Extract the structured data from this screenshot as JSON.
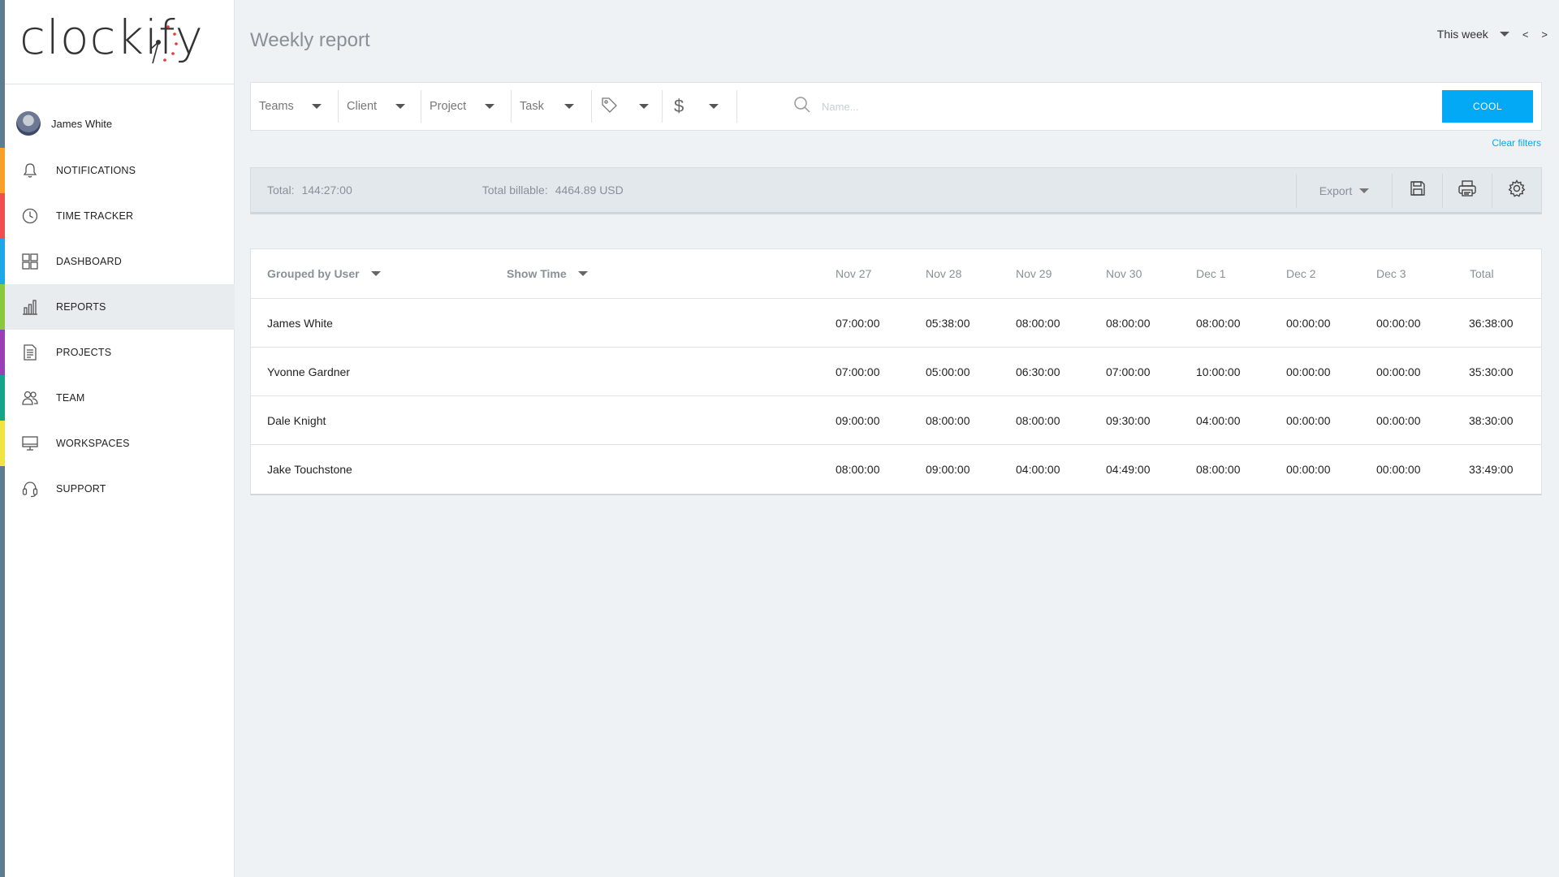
{
  "app": {
    "logo_text": "clockify",
    "accent_color": "#03a9f4"
  },
  "sidebar": {
    "user": {
      "name": "James White"
    },
    "items": [
      {
        "label": "NOTIFICATIONS",
        "icon": "bell-icon",
        "strip_color": "#f7a02a"
      },
      {
        "label": "TIME TRACKER",
        "icon": "clock-icon",
        "strip_color": "#ef4f4f"
      },
      {
        "label": "DASHBOARD",
        "icon": "grid-icon",
        "strip_color": "#1ea7e8"
      },
      {
        "label": "REPORTS",
        "icon": "bar-chart-icon",
        "strip_color": "#8dc63f",
        "active": true
      },
      {
        "label": "PROJECTS",
        "icon": "document-icon",
        "strip_color": "#9b3fb5"
      },
      {
        "label": "TEAM",
        "icon": "team-icon",
        "strip_color": "#17a589"
      },
      {
        "label": "WORKSPACES",
        "icon": "monitor-icon",
        "strip_color": "#f1e342"
      },
      {
        "label": "SUPPORT",
        "icon": "headset-icon",
        "strip_color": "#5f7b8f"
      }
    ]
  },
  "header": {
    "title": "Weekly report",
    "range": "This week",
    "prev": "<",
    "next": ">"
  },
  "filters": {
    "teams": "Teams",
    "client": "Client",
    "project": "Project",
    "task": "Task",
    "tag_icon": "tag-icon",
    "billable_symbol": "$",
    "search_placeholder": "Name...",
    "apply_button": "COOL",
    "clear": "Clear filters"
  },
  "totals": {
    "total_label": "Total:",
    "total_value": "144:27:00",
    "billable_label": "Total billable:",
    "billable_value": "4464.89 USD",
    "export_label": "Export"
  },
  "table": {
    "group_by": "Grouped by User",
    "show": "Show Time",
    "days": [
      "Nov 27",
      "Nov 28",
      "Nov 29",
      "Nov 30",
      "Dec 1",
      "Dec 2",
      "Dec 3"
    ],
    "total_header": "Total",
    "rows": [
      {
        "name": "James White",
        "times": [
          "07:00:00",
          "05:38:00",
          "08:00:00",
          "08:00:00",
          "08:00:00",
          "00:00:00",
          "00:00:00"
        ],
        "total": "36:38:00"
      },
      {
        "name": "Yvonne Gardner",
        "times": [
          "07:00:00",
          "05:00:00",
          "06:30:00",
          "07:00:00",
          "10:00:00",
          "00:00:00",
          "00:00:00"
        ],
        "total": "35:30:00"
      },
      {
        "name": "Dale Knight",
        "times": [
          "09:00:00",
          "08:00:00",
          "08:00:00",
          "09:30:00",
          "04:00:00",
          "00:00:00",
          "00:00:00"
        ],
        "total": "38:30:00"
      },
      {
        "name": "Jake Touchstone",
        "times": [
          "08:00:00",
          "09:00:00",
          "04:00:00",
          "04:49:00",
          "08:00:00",
          "00:00:00",
          "00:00:00"
        ],
        "total": "33:49:00"
      }
    ]
  }
}
